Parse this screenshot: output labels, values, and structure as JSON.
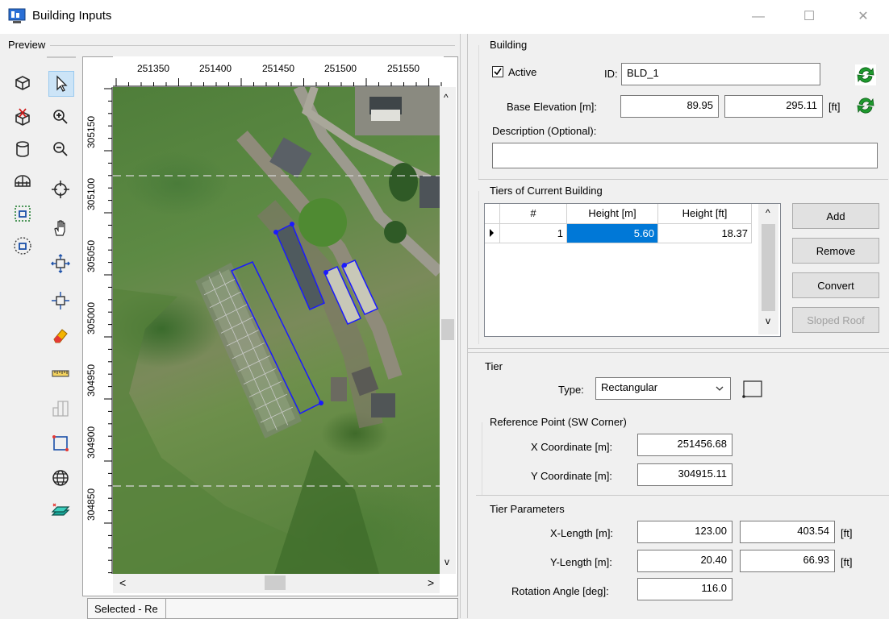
{
  "window": {
    "title": "Building Inputs",
    "minimize": "—",
    "maximize": "☐",
    "close": "✕"
  },
  "preview": {
    "label": "Preview",
    "status": "Selected - Re",
    "x_ticks": [
      "251350",
      "251400",
      "251450",
      "251500",
      "251550"
    ],
    "y_ticks": [
      "305150",
      "305100",
      "305050",
      "305000",
      "304950",
      "304900",
      "304850"
    ],
    "scroll_up": "^",
    "scroll_down": "v",
    "scroll_left": "<",
    "scroll_right": ">",
    "left_tools": [
      "building-3d-icon",
      "delete-building-icon",
      "cylinder-icon",
      "dome-icon",
      "select-region-icon",
      "select-circle-icon"
    ],
    "right_tools": [
      "pointer-icon",
      "zoom-in-icon",
      "zoom-out-icon",
      "center-icon",
      "pan-hand-icon",
      "zoom-extent-icon",
      "fit-icon",
      "eraser-icon",
      "ruler-icon",
      "snap-icon",
      "rectangle-draw-icon",
      "globe-icon",
      "layer-icon"
    ]
  },
  "building": {
    "group_title": "Building",
    "active_label": "Active",
    "active_checked": true,
    "id_label": "ID:",
    "id_value": "BLD_1",
    "base_elev_label": "Base Elevation [m]:",
    "base_elev_m": "89.95",
    "base_elev_ft": "295.11",
    "ft_unit": "[ft]",
    "description_label": "Description (Optional):",
    "description_value": ""
  },
  "tiers": {
    "group_title": "Tiers of Current Building",
    "columns": [
      "#",
      "Height [m]",
      "Height [ft]"
    ],
    "rows": [
      {
        "num": "1",
        "height_m": "5.60",
        "height_ft": "18.37"
      }
    ],
    "buttons": {
      "add": "Add",
      "remove": "Remove",
      "convert": "Convert",
      "sloped_roof": "Sloped Roof"
    }
  },
  "tier": {
    "group_title": "Tier",
    "type_label": "Type:",
    "type_value": "Rectangular",
    "ref_point_title": "Reference Point (SW Corner)",
    "x_coord_label": "X Coordinate [m]:",
    "x_coord_value": "251456.68",
    "y_coord_label": "Y Coordinate [m]:",
    "y_coord_value": "304915.11",
    "params_title": "Tier Parameters",
    "x_length_label": "X-Length [m]:",
    "x_length_m": "123.00",
    "x_length_ft": "403.54",
    "y_length_label": "Y-Length [m]:",
    "y_length_m": "20.40",
    "y_length_ft": "66.93",
    "rotation_label": "Rotation Angle [deg]:",
    "rotation_value": "116.0",
    "ft_unit": "[ft]"
  },
  "colors": {
    "selection": "#0078d7",
    "building_outline": "#1a1aff",
    "refresh_green": "#1e9a2e"
  }
}
